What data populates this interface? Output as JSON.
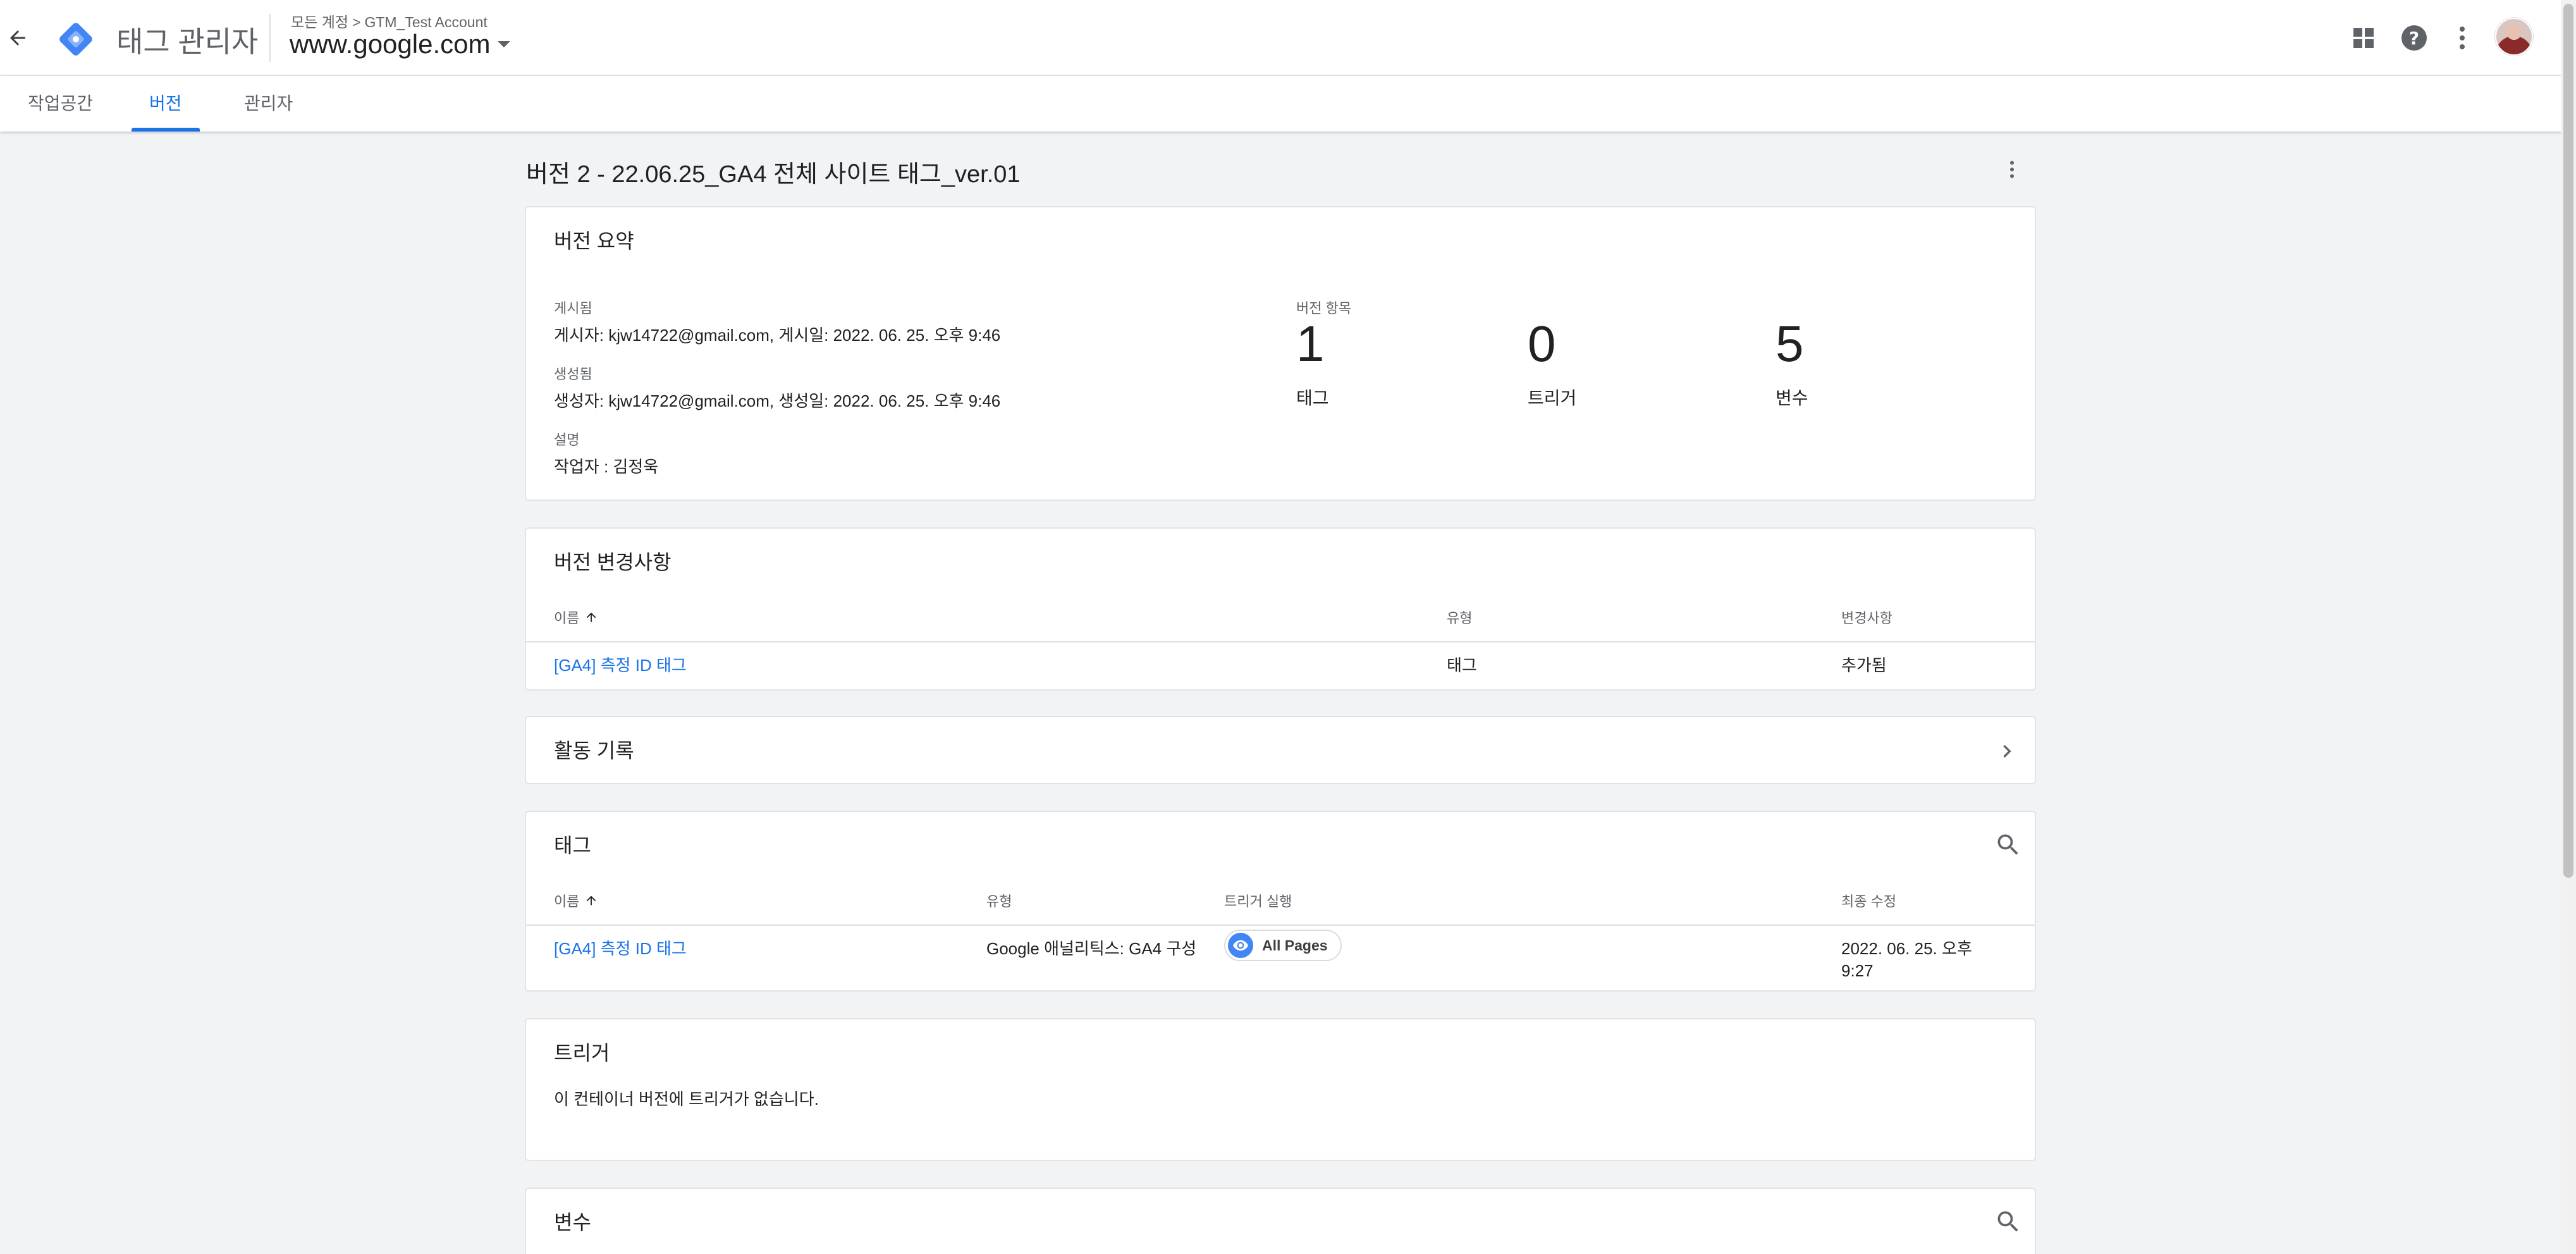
{
  "header": {
    "product_name": "태그 관리자",
    "breadcrumb": {
      "all_accounts": "모든 계정",
      "separator": ">",
      "account": "GTM_Test Account"
    },
    "container": "www.google.com",
    "icons": [
      "back-arrow-icon",
      "tag-manager-logo-icon",
      "apps-grid-icon",
      "help-icon",
      "more-vert-icon",
      "avatar"
    ]
  },
  "tabs": [
    {
      "label": "작업공간",
      "active": false
    },
    {
      "label": "버전",
      "active": true
    },
    {
      "label": "관리자",
      "active": false
    }
  ],
  "page": {
    "title": "버전 2 - 22.06.25_GA4 전체 사이트 태그_ver.01"
  },
  "summary": {
    "title": "버전 요약",
    "published_label": "게시됨",
    "published_value": "게시자: kjw14722@gmail.com, 게시일: 2022. 06. 25. 오후 9:46",
    "created_label": "생성됨",
    "created_value": "생성자: kjw14722@gmail.com, 생성일: 2022. 06. 25. 오후 9:46",
    "description_label": "설명",
    "description_value": "작업자 : 김정욱",
    "items_label": "버전 항목",
    "counts": [
      {
        "value": "1",
        "label": "태그"
      },
      {
        "value": "0",
        "label": "트리거"
      },
      {
        "value": "5",
        "label": "변수"
      }
    ]
  },
  "changes": {
    "title": "버전 변경사항",
    "columns": {
      "name": "이름",
      "type": "유형",
      "change": "변경사항"
    },
    "rows": [
      {
        "name": "[GA4] 측정 ID 태그",
        "type": "태그",
        "change": "추가됨"
      }
    ]
  },
  "activity": {
    "title": "활동 기록"
  },
  "tags": {
    "title": "태그",
    "columns": {
      "name": "이름",
      "type": "유형",
      "triggers": "트리거 실행",
      "modified": "최종 수정"
    },
    "rows": [
      {
        "name": "[GA4] 측정 ID 태그",
        "type": "Google 애널리틱스: GA4 구성",
        "trigger": "All Pages",
        "modified_line1": "2022. 06. 25. 오후",
        "modified_line2": "9:27"
      }
    ]
  },
  "triggers": {
    "title": "트리거",
    "empty_text": "이 컨테이너 버전에 트리거가 없습니다."
  },
  "variables": {
    "title": "변수"
  },
  "colors": {
    "accent": "#1a73e8",
    "background": "#f1f3f4",
    "card": "#ffffff",
    "chip_icon": "#4285f4"
  }
}
